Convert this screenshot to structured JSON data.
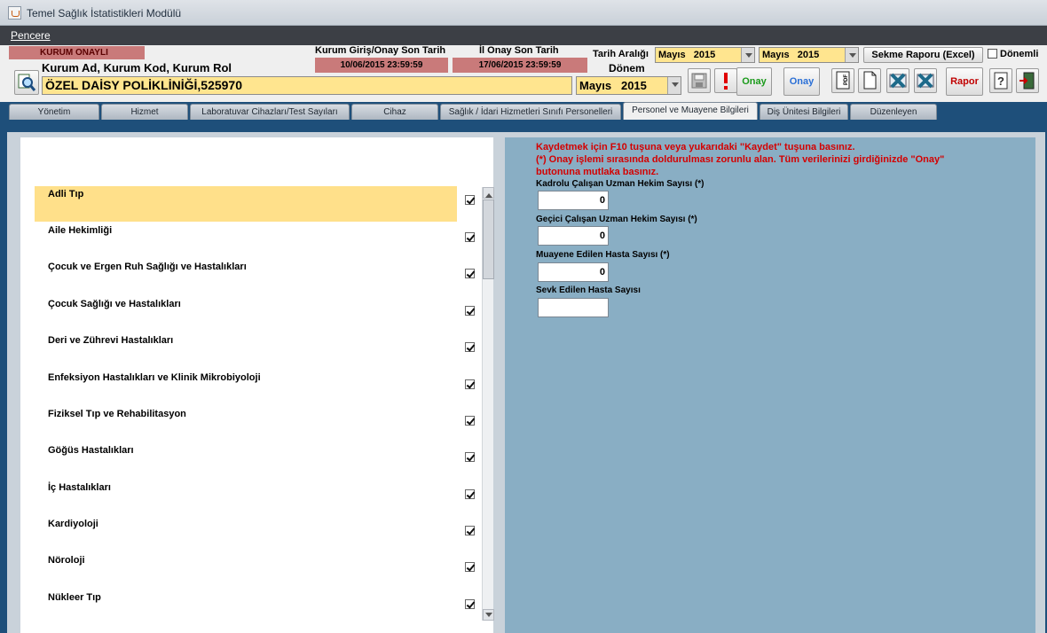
{
  "window": {
    "title": "Temel Sağlık İstatistikleri Modülü"
  },
  "menu": {
    "items": [
      "Pencere"
    ]
  },
  "header": {
    "status_badge": "KURUM ONAYLI",
    "institution_caption": "Kurum Ad, Kurum Kod, Kurum Rol",
    "institution_value": "ÖZEL DAİSY POLİKLİNİĞİ,525970",
    "deadline_entry_label": "Kurum Giriş/Onay Son Tarih",
    "deadline_entry_value": "10/06/2015 23:59:59",
    "deadline_province_label": "İl Onay Son Tarih",
    "deadline_province_value": "17/06/2015 23:59:59",
    "date_range_label": "Tarih Aralığı",
    "date_range_from": "Mayıs   2015",
    "date_range_to": "Mayıs   2015",
    "period_label": "Dönem",
    "period_value": "Mayıs   2015",
    "tab_report_button": "Sekme Raporu (Excel)",
    "periodic_checkbox_label": "Dönemli",
    "approve_button_1": "Onay",
    "approve_button_2": "Onay",
    "report_button": "Rapor",
    "colors": {
      "approve_green": "#1a9a1a",
      "approve_blue": "#2a6fd6",
      "report_red": "#c00000"
    }
  },
  "tabs": [
    {
      "label": "Yönetim"
    },
    {
      "label": "Hizmet"
    },
    {
      "label": "Laboratuvar Cihazları/Test Sayıları"
    },
    {
      "label": "Cihaz"
    },
    {
      "label": "Sağlık / İdari Hizmetleri Sınıfı Personelleri"
    },
    {
      "label": "Personel ve Muayene Bilgileri"
    },
    {
      "label": "Diş Ünitesi Bilgileri"
    },
    {
      "label": "Düzenleyen"
    }
  ],
  "specialties": [
    {
      "label": "Adli Tıp",
      "checked": true
    },
    {
      "label": "Aile Hekimliği",
      "checked": true
    },
    {
      "label": "Çocuk ve Ergen Ruh Sağlığı ve Hastalıkları",
      "checked": true
    },
    {
      "label": "Çocuk Sağlığı ve Hastalıkları",
      "checked": true
    },
    {
      "label": "Deri ve Zührevi Hastalıkları",
      "checked": true
    },
    {
      "label": "Enfeksiyon Hastalıkları ve Klinik Mikrobiyoloji",
      "checked": true
    },
    {
      "label": "Fiziksel Tıp ve Rehabilitasyon",
      "checked": true
    },
    {
      "label": "Göğüs Hastalıkları",
      "checked": true
    },
    {
      "label": "İç Hastalıkları",
      "checked": true
    },
    {
      "label": "Kardiyoloji",
      "checked": true
    },
    {
      "label": "Nöroloji",
      "checked": true
    },
    {
      "label": "Nükleer Tıp",
      "checked": true
    }
  ],
  "form": {
    "warning_1": "Kaydetmek için F10 tuşuna veya yukarıdaki \"Kaydet\" tuşuna basınız.",
    "warning_2": "(*) Onay işlemi sırasında doldurulması zorunlu alan. Tüm verilerinizi girdiğinizde \"Onay\"",
    "warning_3": "butonuna mutlaka basınız.",
    "fields": [
      {
        "label": "Kadrolu Çalışan Uzman Hekim Sayısı (*)",
        "value": "0"
      },
      {
        "label": "Geçici Çalışan Uzman Hekim Sayısı (*)",
        "value": "0"
      },
      {
        "label": "Muayene Edilen Hasta Sayısı (*)",
        "value": "0"
      },
      {
        "label": "Sevk Edilen Hasta Sayısı",
        "value": ""
      }
    ]
  }
}
